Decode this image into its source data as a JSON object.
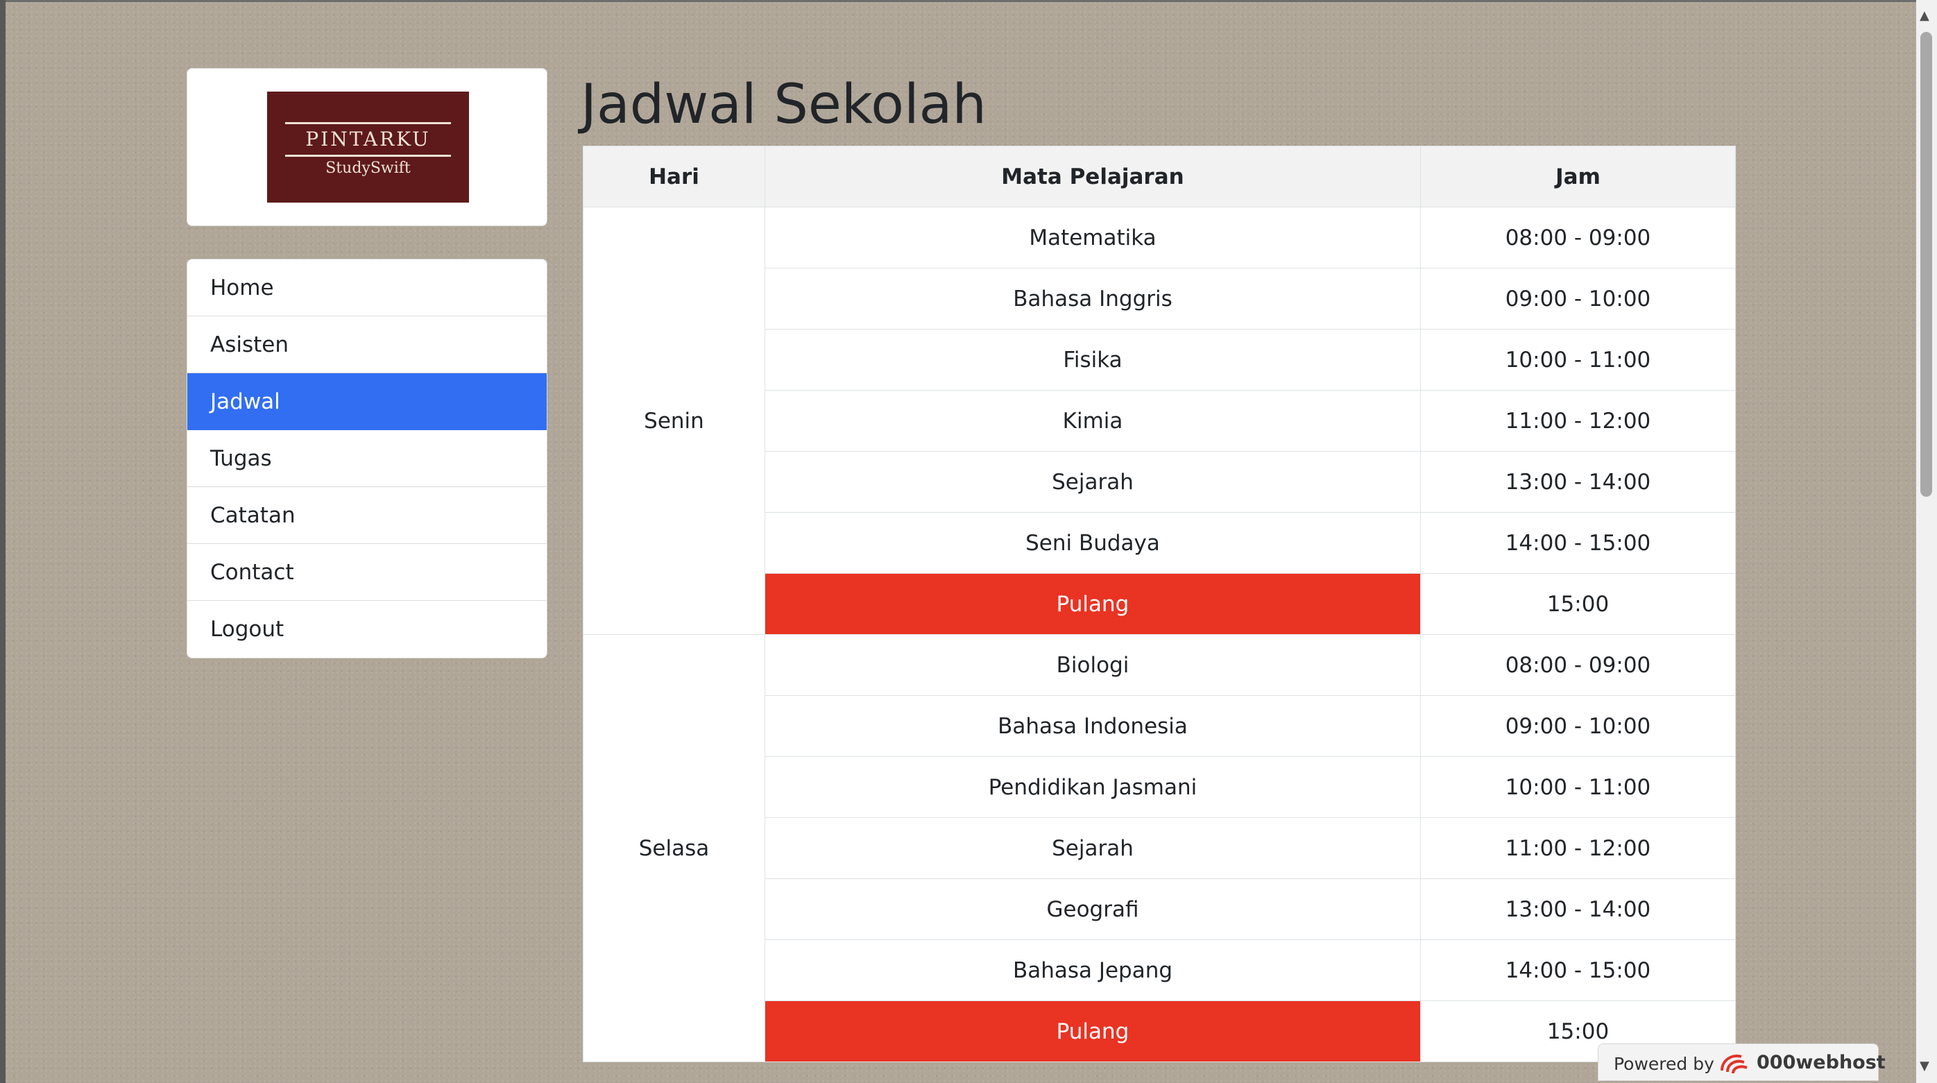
{
  "logo": {
    "title": "PINTARKU",
    "subtitle": "StudySwift"
  },
  "nav": {
    "items": [
      {
        "label": "Home",
        "active": false
      },
      {
        "label": "Asisten",
        "active": false
      },
      {
        "label": "Jadwal",
        "active": true
      },
      {
        "label": "Tugas",
        "active": false
      },
      {
        "label": "Catatan",
        "active": false
      },
      {
        "label": "Contact",
        "active": false
      },
      {
        "label": "Logout",
        "active": false
      }
    ]
  },
  "page_title": "Jadwal Sekolah",
  "table": {
    "headers": {
      "day": "Hari",
      "subject": "Mata Pelajaran",
      "time": "Jam"
    },
    "days": [
      {
        "name": "Senin",
        "rows": [
          {
            "subject": "Matematika",
            "time": "08:00 - 09:00"
          },
          {
            "subject": "Bahasa Inggris",
            "time": "09:00 - 10:00"
          },
          {
            "subject": "Fisika",
            "time": "10:00 - 11:00"
          },
          {
            "subject": "Kimia",
            "time": "11:00 - 12:00"
          },
          {
            "subject": "Sejarah",
            "time": "13:00 - 14:00"
          },
          {
            "subject": "Seni Budaya",
            "time": "14:00 - 15:00"
          },
          {
            "subject": "Pulang",
            "time": "15:00"
          }
        ]
      },
      {
        "name": "Selasa",
        "rows": [
          {
            "subject": "Biologi",
            "time": "08:00 - 09:00"
          },
          {
            "subject": "Bahasa Indonesia",
            "time": "09:00 - 10:00"
          },
          {
            "subject": "Pendidikan Jasmani",
            "time": "10:00 - 11:00"
          },
          {
            "subject": "Sejarah",
            "time": "11:00 - 12:00"
          },
          {
            "subject": "Geografi",
            "time": "13:00 - 14:00"
          },
          {
            "subject": "Bahasa Jepang",
            "time": "14:00 - 15:00"
          },
          {
            "subject": "Pulang",
            "time": "15:00"
          }
        ]
      }
    ]
  },
  "badge": {
    "label": "Powered by",
    "brand": "000webhost"
  },
  "colors": {
    "active_nav": "#316ef2",
    "pulang": "#e93323",
    "logo_bg": "#5e1a1a"
  }
}
